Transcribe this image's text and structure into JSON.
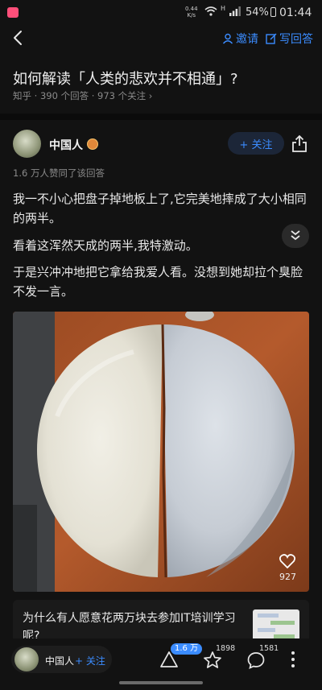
{
  "status": {
    "net_speed_value": "0.44",
    "net_speed_unit": "K/s",
    "signal_label": "H",
    "battery": "54%",
    "time": "01:44"
  },
  "nav": {
    "invite": "邀请",
    "write_answer": "写回答"
  },
  "question": {
    "title": "如何解读「人类的悲欢并不相通」?",
    "meta": "知乎 · 390 个回答 · 973 个关注 ›"
  },
  "answer": {
    "author": "中国人",
    "follow_label": "+ 关注",
    "likes_line": "1.6 万人赞同了该回答",
    "paragraphs": [
      "我一不小心把盘子掉地板上了,它完美地摔成了大小相同的两半。",
      "看着这浑然天成的两半,我特激动。",
      "于是兴冲冲地把它拿给我爱人看。没想到她却拉个臭脸不发一言。"
    ],
    "image_like_count": "927"
  },
  "recommendation": {
    "title": "为什么有人愿意花两万块去参加IT培训学习呢?"
  },
  "bottom_bar": {
    "author": "中国人",
    "follow_label": "+ 关注",
    "vote_count": "1.6 万",
    "favorites_count": "1898",
    "comments_count": "1581"
  },
  "colors": {
    "background": "#121212",
    "accent": "#3b8cff",
    "text": "#e8e8e8",
    "muted": "#8a8a8a"
  }
}
